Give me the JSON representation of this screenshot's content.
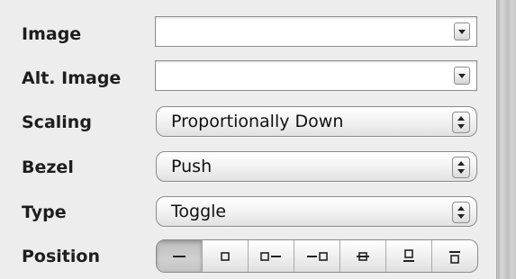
{
  "rows": {
    "image": {
      "label": "Image",
      "value": ""
    },
    "alt_image": {
      "label": "Alt. Image",
      "value": ""
    },
    "scaling": {
      "label": "Scaling",
      "value": "Proportionally Down"
    },
    "bezel": {
      "label": "Bezel",
      "value": "Push"
    },
    "type": {
      "label": "Type",
      "value": "Toggle"
    },
    "position": {
      "label": "Position",
      "selected_index": 0,
      "options": [
        "no-image",
        "image-only",
        "image-left",
        "image-right",
        "image-overlaps",
        "image-below",
        "image-above"
      ]
    }
  },
  "colors": {
    "background": "#ededed",
    "text": "#1e1e1e",
    "selected_segment": "#c4c4c4"
  }
}
